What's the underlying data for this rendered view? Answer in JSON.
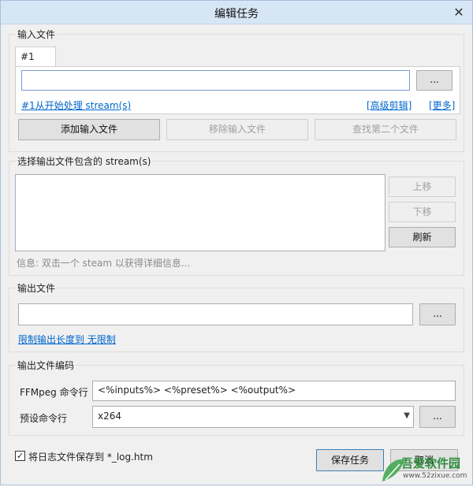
{
  "window": {
    "title": "编辑任务",
    "close": "✕"
  },
  "input_files": {
    "section_title": "输入文件",
    "tab_label": "#1",
    "path_value": "",
    "browse_label": "...",
    "start_link": "#1从开始处理 stream(s)",
    "advanced_link": "[高级剪辑]",
    "more_link": "[更多]",
    "add_button": "添加输入文件",
    "remove_button": "移除输入文件",
    "find_button": "查找第二个文件"
  },
  "streams": {
    "section_title": "选择输出文件包含的 stream(s)",
    "move_up": "上移",
    "move_down": "下移",
    "refresh": "刷新",
    "info": "信息: 双击一个 steam 以获得详细信息..."
  },
  "output_file": {
    "section_title": "输出文件",
    "path_value": "",
    "browse_label": "...",
    "limit_link": "限制输出长度到 无限制"
  },
  "encoding": {
    "section_title": "输出文件编码",
    "cmd_label": "FFMpeg 命令行",
    "cmd_value": "<%inputs%> <%preset%> <%output%>",
    "preset_label": "预设命令行",
    "preset_value": "x264",
    "preset_browse": "..."
  },
  "footer": {
    "save_log": "将日志文件保存到 *_log.htm",
    "save_log_checked": true,
    "save_button": "保存任务",
    "cancel_button": "取消"
  },
  "watermark": {
    "name": "吾爱软件园",
    "url": "www.52zixue.com"
  },
  "colors": {
    "link": "#0066cc",
    "titlebar": "#d7e6f5",
    "focus_border": "#7a9cd3"
  }
}
